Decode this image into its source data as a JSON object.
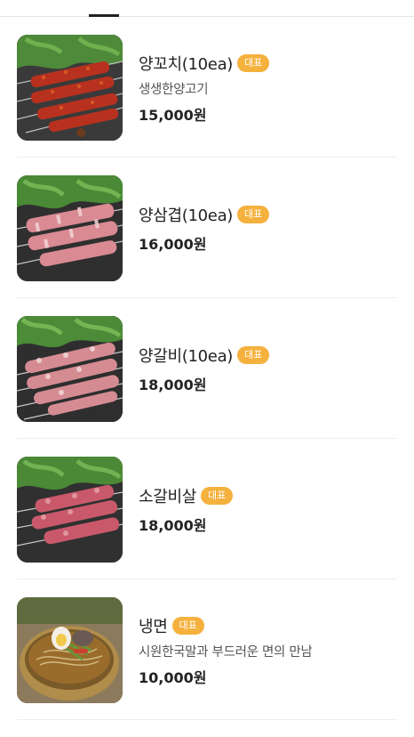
{
  "menu": {
    "items": [
      {
        "name": "양꼬치(10ea)",
        "badge": "대표",
        "description": "생생한양고기",
        "price": "15,000원",
        "image_icon": "lamb-skewer-spicy-photo"
      },
      {
        "name": "양삼겹(10ea)",
        "badge": "대표",
        "description": "",
        "price": "16,000원",
        "image_icon": "lamb-belly-skewer-photo"
      },
      {
        "name": "양갈비(10ea)",
        "badge": "대표",
        "description": "",
        "price": "18,000원",
        "image_icon": "lamb-rib-skewer-photo"
      },
      {
        "name": "소갈비살",
        "badge": "대표",
        "description": "",
        "price": "18,000원",
        "image_icon": "beef-rib-skewer-photo"
      },
      {
        "name": "냉면",
        "badge": "대표",
        "description": "시원한국말과 부드러운 면의 만남",
        "price": "10,000원",
        "image_icon": "cold-noodle-photo"
      }
    ]
  },
  "colors": {
    "badge": "#f5b13d",
    "price": "#222222",
    "divider": "#eeeeee"
  }
}
